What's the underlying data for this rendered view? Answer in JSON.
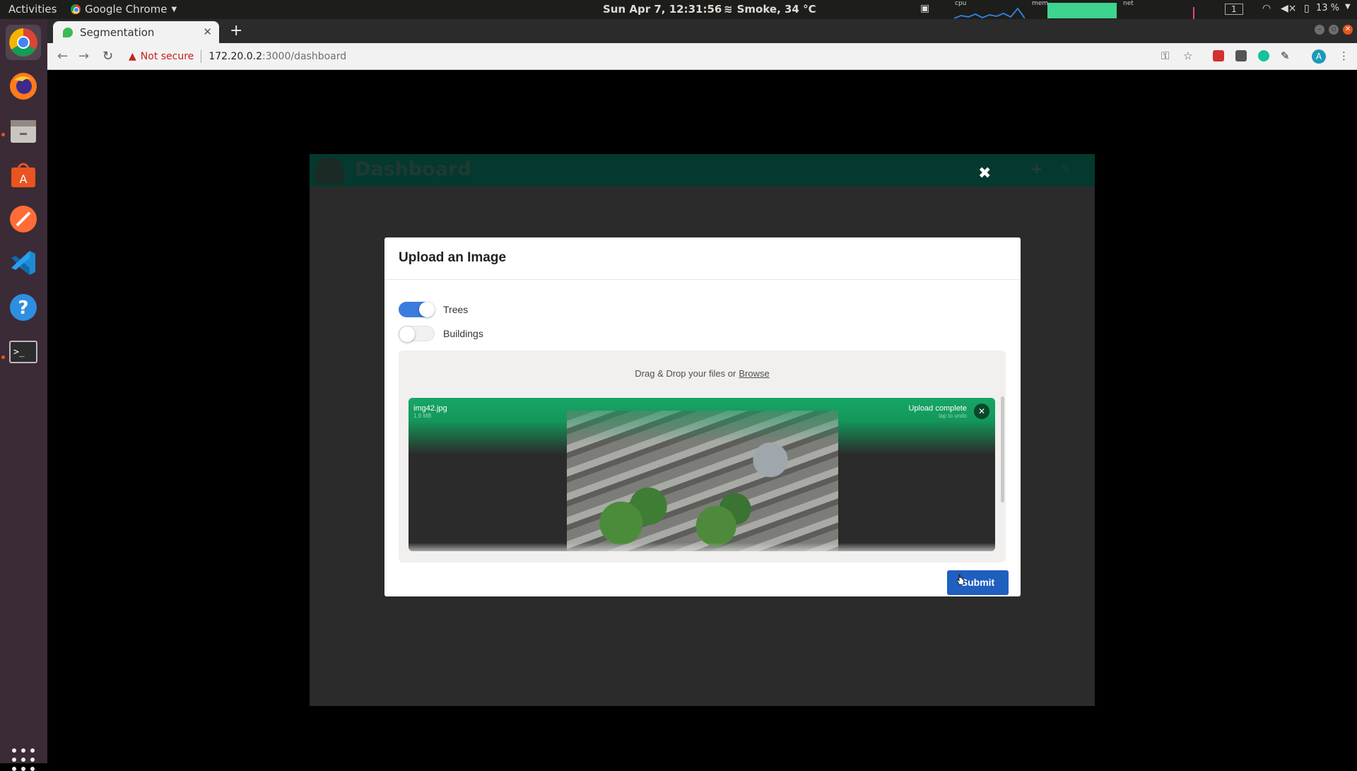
{
  "topbar": {
    "activities": "Activities",
    "app_menu": "Google Chrome",
    "clock": "Sun Apr  7, 12:31:56",
    "weather": "Smoke, 34 °C",
    "cpu_label": "cpu",
    "mem_label": "mem",
    "net_label": "net",
    "workspace": "1",
    "battery": "13 %"
  },
  "browser": {
    "tab_title": "Segmentation",
    "security_label": "Not secure",
    "url_host": "172.20.0.2",
    "url_path": ":3000/dashboard",
    "profile_initial": "A"
  },
  "dashboard": {
    "title": "Dashboard"
  },
  "modal": {
    "title": "Upload an Image",
    "toggles": [
      {
        "label": "Trees",
        "on": true
      },
      {
        "label": "Buildings",
        "on": false
      }
    ],
    "dropzone_text": "Drag & Drop your files or",
    "browse_link": "Browse",
    "file": {
      "name": "img42.jpg",
      "size": "1.9 MB",
      "status": "Upload complete",
      "status_sub": "tap to undo"
    },
    "submit_label": "Submit"
  },
  "colors": {
    "accent": "#3b7ddd",
    "submit": "#1f5fbf",
    "upload_success": "#17a665",
    "dock": "#3b2b36"
  }
}
